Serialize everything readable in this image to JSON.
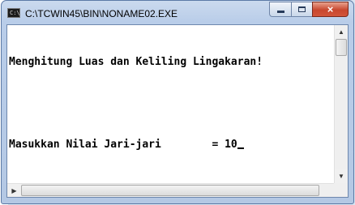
{
  "window": {
    "title": "C:\\TCWIN45\\BIN\\NONAME02.EXE",
    "buttons": {
      "minimize": "minimize",
      "maximize": "maximize",
      "close": "×"
    }
  },
  "console": {
    "lines": [
      "Menghitung Luas dan Keliling Lingakaran!",
      "",
      "Masukkan Nilai Jari-jari        = 10"
    ]
  },
  "icons": {
    "app": "console-app-icon",
    "scroll_up": "▲",
    "scroll_down": "▼",
    "scroll_left": "◀",
    "scroll_right": "▶"
  },
  "colors": {
    "frame": "#b9cde9",
    "close_button": "#c8472e",
    "console_bg": "#ffffff",
    "console_text": "#000000"
  }
}
